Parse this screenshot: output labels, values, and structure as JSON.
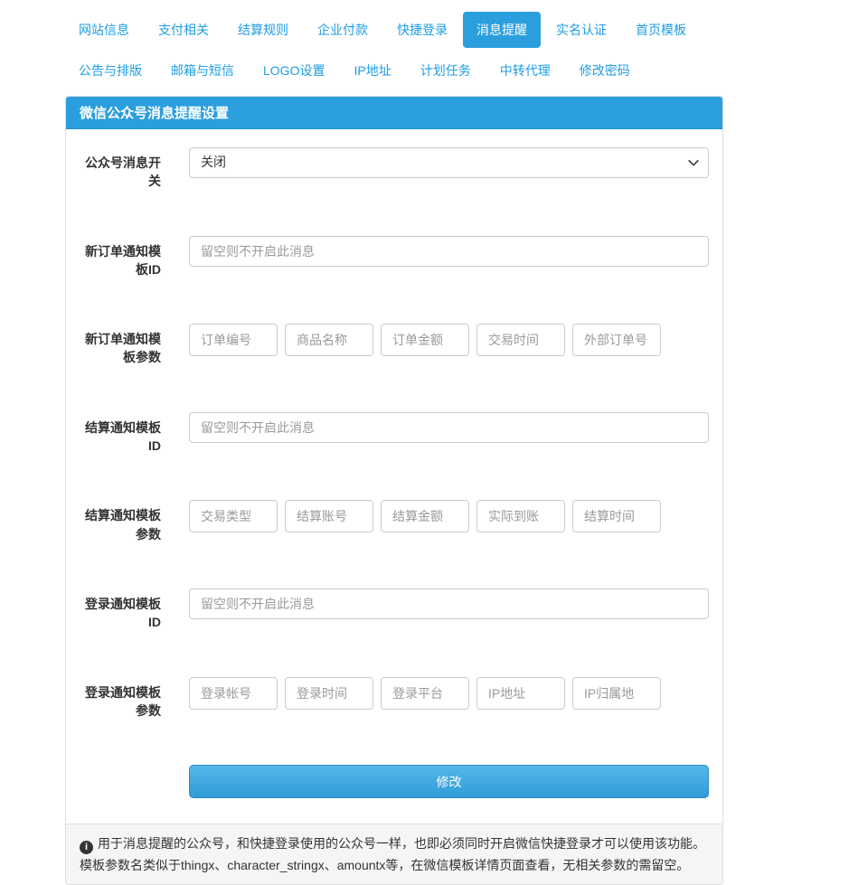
{
  "tabs": {
    "row1": [
      {
        "label": "网站信息",
        "active": false
      },
      {
        "label": "支付相关",
        "active": false
      },
      {
        "label": "结算规则",
        "active": false
      },
      {
        "label": "企业付款",
        "active": false
      },
      {
        "label": "快捷登录",
        "active": false
      },
      {
        "label": "消息提醒",
        "active": true
      },
      {
        "label": "实名认证",
        "active": false
      },
      {
        "label": "首页模板",
        "active": false
      }
    ],
    "row2": [
      {
        "label": "公告与排版"
      },
      {
        "label": "邮箱与短信"
      },
      {
        "label": "LOGO设置"
      },
      {
        "label": "IP地址"
      },
      {
        "label": "计划任务"
      },
      {
        "label": "中转代理"
      },
      {
        "label": "修改密码"
      }
    ]
  },
  "panel": {
    "title": "微信公众号消息提醒设置"
  },
  "form": {
    "switch": {
      "label": "公众号消息开关",
      "value": "关闭"
    },
    "order_id": {
      "label": "新订单通知模板ID",
      "placeholder": "留空则不开启此消息"
    },
    "order_params": {
      "label": "新订单通知模板参数",
      "placeholders": [
        "订单编号",
        "商品名称",
        "订单金额",
        "交易时间",
        "外部订单号"
      ]
    },
    "settle_id": {
      "label": "结算通知模板ID",
      "placeholder": "留空则不开启此消息"
    },
    "settle_params": {
      "label": "结算通知模板参数",
      "placeholders": [
        "交易类型",
        "结算账号",
        "结算金额",
        "实际到账",
        "结算时间"
      ]
    },
    "login_id": {
      "label": "登录通知模板ID",
      "placeholder": "留空则不开启此消息"
    },
    "login_params": {
      "label": "登录通知模板参数",
      "placeholders": [
        "登录帐号",
        "登录时间",
        "登录平台",
        "IP地址",
        "IP归属地"
      ]
    },
    "submit_label": "修改"
  },
  "footer": {
    "line1": "用于消息提醒的公众号，和快捷登录使用的公众号一样，也即必须同时开启微信快捷登录才可以使用该功能。",
    "line2": "模板参数名类似于thingx、character_stringx、amountx等，在微信模板详情页面查看，无相关参数的需留空。"
  },
  "colors": {
    "accent": "#2b9fdd",
    "link": "#1e9de5",
    "footer_bg": "#f5f5f5",
    "input_border": "#cccccc"
  }
}
